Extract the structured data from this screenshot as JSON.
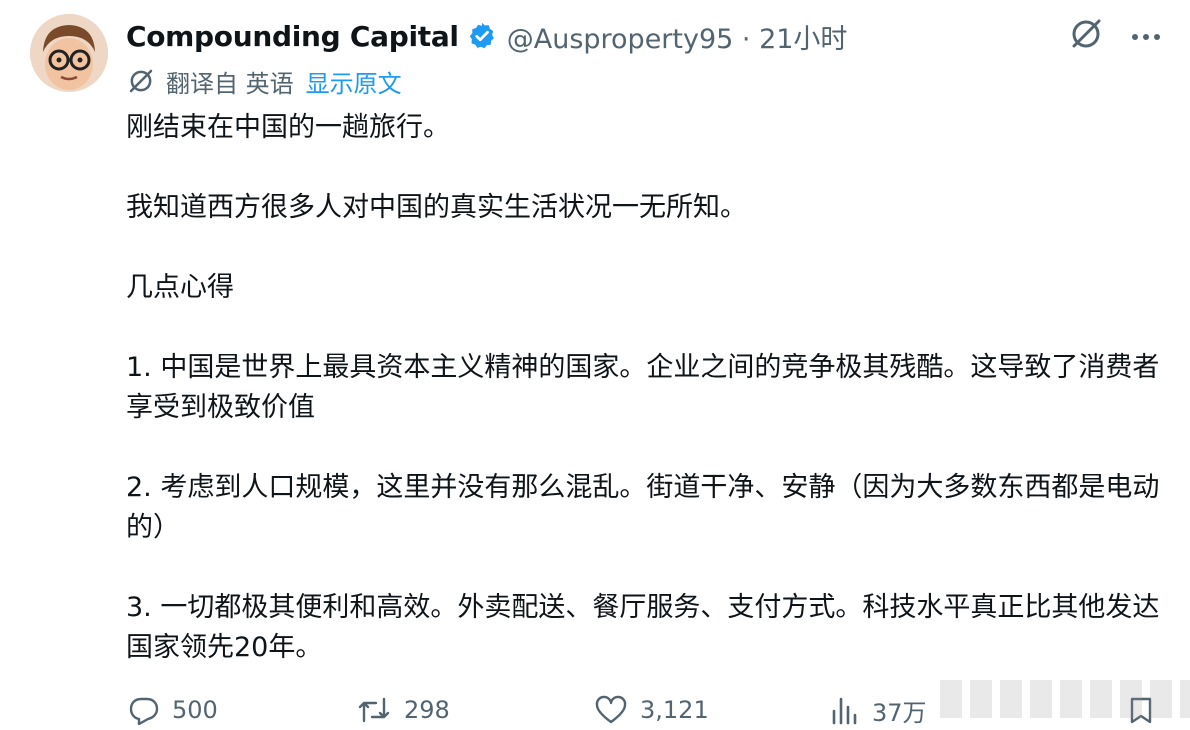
{
  "header": {
    "display_name": "Compounding Capital",
    "handle": "@Ausproperty95",
    "separator": " · ",
    "time_ago": "21小时"
  },
  "translation": {
    "label": "翻译自 英语",
    "show_original": "显示原文"
  },
  "tweet": {
    "paragraphs": [
      "刚结束在中国的一趟旅行。",
      "我知道西方很多人对中国的真实生活状况一无所知。",
      "几点心得",
      "1. 中国是世界上最具资本主义精神的国家。企业之间的竞争极其残酷。这导致了消费者享受到极致价值",
      "2. 考虑到人口规模，这里并没有那么混乱。街道干净、安静（因为大多数东西都是电动的）",
      "3. 一切都极其便利和高效。外卖配送、餐厅服务、支付方式。科技水平真正比其他发达国家领先20年。"
    ]
  },
  "actions": {
    "replies": "500",
    "retweets": "298",
    "likes": "3,121",
    "views": "37万"
  },
  "icons": {
    "verified": "verified-badge-icon",
    "grok": "grok-icon",
    "more": "more-icon",
    "translate": "translate-icon",
    "reply": "reply-icon",
    "retweet": "retweet-icon",
    "like": "heart-icon",
    "views": "views-icon",
    "bookmark": "bookmark-icon"
  },
  "colors": {
    "text": "#0f1419",
    "secondary": "#536471",
    "accent": "#1d9bf0"
  }
}
